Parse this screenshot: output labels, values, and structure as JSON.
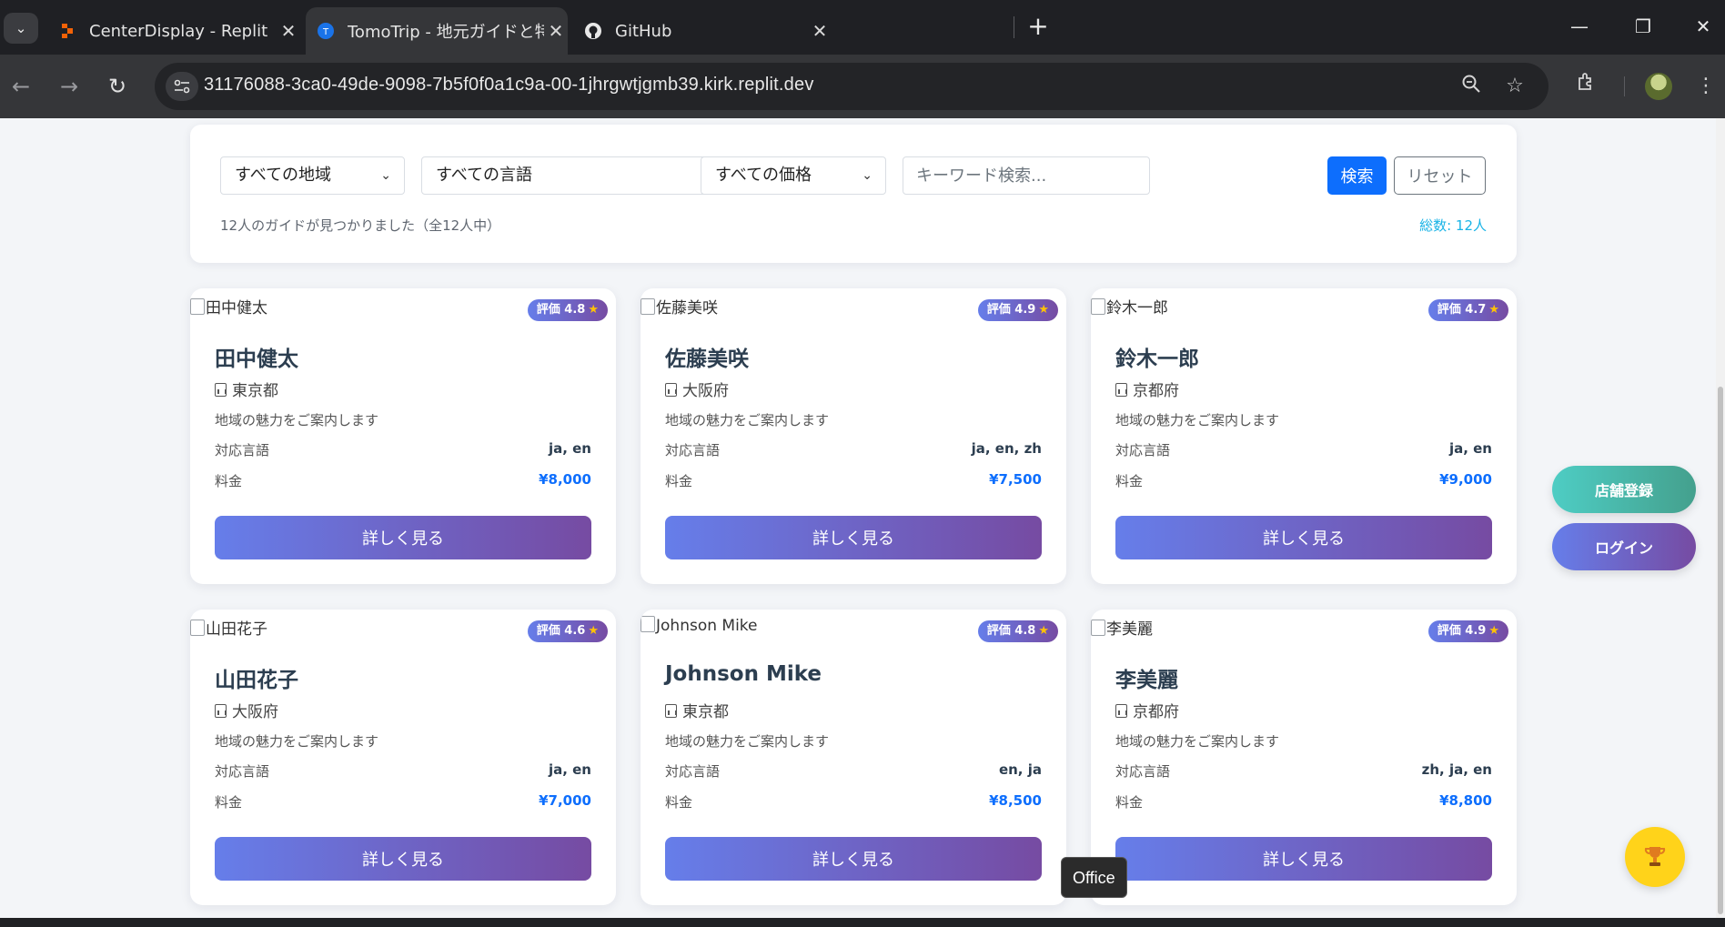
{
  "browser": {
    "tabs": [
      {
        "title": "CenterDisplay - Replit",
        "active": false
      },
      {
        "title": "TomoTrip - 地元ガイドと特別な旅",
        "active": true
      },
      {
        "title": "GitHub",
        "active": false
      }
    ],
    "url": "31176088-3ca0-49de-9098-7b5f0f0a1c9a-00-1jhrgwtjgmb39.kirk.replit.dev"
  },
  "filters": {
    "region": "すべての地域",
    "language": "すべての言語",
    "price": "すべての価格",
    "keyword_placeholder": "キーワード検索...",
    "search_label": "検索",
    "reset_label": "リセット",
    "result_text": "12人のガイドが見つかりました（全12人中）",
    "total_text": "総数: 12人"
  },
  "labels": {
    "languages": "対応言語",
    "price": "料金",
    "detail_button": "詳しく見る",
    "rating_prefix": "評価"
  },
  "guides": [
    {
      "name": "田中健太",
      "rating": "評価 4.8",
      "location": "東京都",
      "description": "地域の魅力をご案内します",
      "languages": "ja, en",
      "price": "¥8,000"
    },
    {
      "name": "佐藤美咲",
      "rating": "評価 4.9",
      "location": "大阪府",
      "description": "地域の魅力をご案内します",
      "languages": "ja, en, zh",
      "price": "¥7,500"
    },
    {
      "name": "鈴木一郎",
      "rating": "評価 4.7",
      "location": "京都府",
      "description": "地域の魅力をご案内します",
      "languages": "ja, en",
      "price": "¥9,000"
    },
    {
      "name": "山田花子",
      "rating": "評価 4.6",
      "location": "大阪府",
      "description": "地域の魅力をご案内します",
      "languages": "ja, en",
      "price": "¥7,000"
    },
    {
      "name": "Johnson Mike",
      "rating": "評価 4.8",
      "location": "東京都",
      "description": "地域の魅力をご案内します",
      "languages": "en, ja",
      "price": "¥8,500"
    },
    {
      "name": "李美麗",
      "rating": "評価 4.9",
      "location": "京都府",
      "description": "地域の魅力をご案内します",
      "languages": "zh, ja, en",
      "price": "¥8,800"
    }
  ],
  "floating": {
    "shop_register": "店舗登録",
    "login": "ログイン",
    "tooltip": "Office"
  },
  "colors": {
    "primary": "#0d6efd",
    "gradient_start": "#667eea",
    "gradient_end": "#764ba2",
    "teal_start": "#4ecdc4",
    "teal_end": "#44a08d",
    "trophy_bg": "#ffd31a"
  },
  "icons": [
    "chevron-down-icon",
    "close-icon",
    "plus-icon",
    "back-arrow-icon",
    "forward-arrow-icon",
    "reload-icon",
    "site-settings-icon",
    "zoom-icon",
    "star-bookmark-icon",
    "extensions-icon",
    "kebab-menu-icon",
    "location-icon",
    "star-icon",
    "trophy-icon"
  ]
}
